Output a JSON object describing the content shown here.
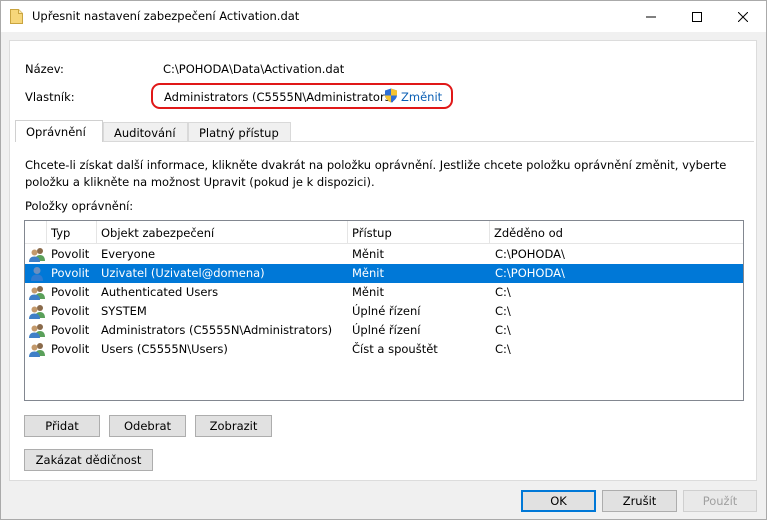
{
  "window": {
    "title": "Upřesnit nastavení zabezpečení Activation.dat"
  },
  "info": {
    "name_label": "Název:",
    "name_value": "C:\\POHODA\\Data\\Activation.dat",
    "owner_label": "Vlastník:",
    "owner_value": "Administrators  (C5555N\\Administrators)",
    "change_link": "Změnit"
  },
  "tabs": [
    {
      "label": "Oprávnění",
      "active": true
    },
    {
      "label": "Auditování",
      "active": false
    },
    {
      "label": "Platný přístup",
      "active": false
    }
  ],
  "description": "Chcete-li získat další informace, klikněte dvakrát na položku oprávnění. Jestliže chcete položku oprávnění změnit, vyberte položku a klikněte na možnost Upravit (pokud je k dispozici).",
  "entries_label": "Položky oprávnění:",
  "columns": [
    "Typ",
    "Objekt zabezpečení",
    "Přístup",
    "Zděděno od"
  ],
  "rows": [
    {
      "type": "Povolit",
      "principal": "Everyone",
      "access": "Měnit",
      "inherited": "C:\\POHODA\\",
      "icon": "group-icon",
      "selected": false
    },
    {
      "type": "Povolit",
      "principal": "Uzivatel (Uzivatel@domena)",
      "access": "Měnit",
      "inherited": "C:\\POHODA\\",
      "icon": "user-icon",
      "selected": true
    },
    {
      "type": "Povolit",
      "principal": "Authenticated Users",
      "access": "Měnit",
      "inherited": "C:\\",
      "icon": "group-icon",
      "selected": false
    },
    {
      "type": "Povolit",
      "principal": "SYSTEM",
      "access": "Úplné řízení",
      "inherited": "C:\\",
      "icon": "group-icon",
      "selected": false
    },
    {
      "type": "Povolit",
      "principal": "Administrators  (C5555N\\Administrators)",
      "access": "Úplné řízení",
      "inherited": "C:\\",
      "icon": "group-icon",
      "selected": false
    },
    {
      "type": "Povolit",
      "principal": "Users  (C5555N\\Users)",
      "access": "Číst a spouštět",
      "inherited": "C:\\",
      "icon": "group-icon",
      "selected": false
    }
  ],
  "buttons": {
    "add": "Přidat",
    "remove": "Odebrat",
    "view": "Zobrazit",
    "disable_inheritance": "Zakázat dědičnost",
    "ok": "OK",
    "cancel": "Zrušit",
    "apply": "Použít"
  },
  "colors": {
    "accent": "#0078d7",
    "highlight_ring": "#e01818",
    "link": "#0b5fb4"
  }
}
